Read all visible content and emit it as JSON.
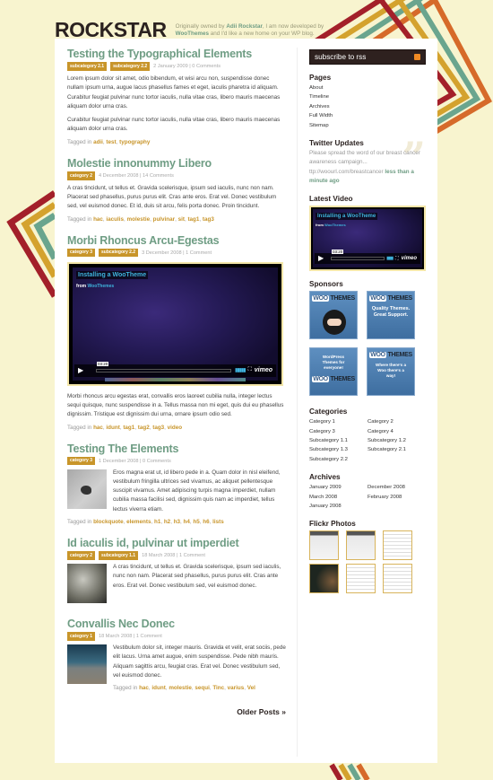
{
  "site": {
    "logo": "ROCKSTAR",
    "tagline_pre": "Originally owned by ",
    "tagline_author": "Adii Rockstar",
    "tagline_mid": ", I am now developed by ",
    "tagline_dev": "WooThemes",
    "tagline_post": " and I'd like a new home on your WP blog."
  },
  "colors": {
    "background": "#f8f4cf",
    "accent_green": "#6f9d84",
    "accent_gold": "#c8952a",
    "dark_brown": "#2e211f",
    "stripe_red": "#a3202a",
    "stripe_gold": "#d4a22e",
    "stripe_teal": "#6aa58e",
    "stripe_orange": "#d66a2a"
  },
  "posts": [
    {
      "title": "Testing the Typographical Elements",
      "categories": [
        "subcategory 2.1",
        "subcategory 2.2"
      ],
      "date": "2 January 2009 | 0 Comments",
      "paragraphs": [
        "Lorem ipsum dolor sit amet, odio bibendum, et wisi arcu non, suspendisse donec nullam ipsum urna, augue lacus phasellus fames et eget, iaculis pharetra id aliquam. Curabitur feugiat pulvinar nunc tortor iaculis, nulla vitae cras, libero mauris maecenas aliquam dolor urna cras.",
        "Curabitur feugiat pulvinar nunc tortor iaculis, nulla vitae cras, libero mauris maecenas aliquam dolor urna cras."
      ],
      "tagged_label": "Tagged in",
      "tags": [
        "adii",
        "test",
        "typography"
      ]
    },
    {
      "title": "Molestie innonummy Libero",
      "categories": [
        "category 2"
      ],
      "date": "4 December 2008 | 14 Comments",
      "paragraphs": [
        "A cras tincidunt, ut tellus et. Gravida scelerisque, ipsum sed iaculis, nunc non nam. Placerat sed phasellus, purus purus elit. Cras ante eros. Erat vel. Donec vestibulum sed, vel euismod donec. Et id, duis sit arcu, felis porta donec. Proin tincidunt."
      ],
      "tagged_label": "Tagged in",
      "tags": [
        "hac",
        "iaculis",
        "molestie",
        "pulvinar",
        "sit",
        "tag1",
        "tag3"
      ]
    },
    {
      "title": "Morbi Rhoncus Arcu-Egestas",
      "categories": [
        "category 3",
        "subcategory 2.2"
      ],
      "date": "3 December 2008 | 1 Comment",
      "video": {
        "title": "Installing a WooTheme",
        "from_label": "from",
        "from_author": "WooThemes",
        "time": "03:20",
        "brand": "vimeo"
      },
      "paragraphs": [
        "Morbi rhoncus arcu egestas erat, convallis eros laoreet cubilia nulla, integer lectus sequi quisque, nunc suspendisse in a. Tellus massa non mi eget, quis dui eu phasellus dignissim. Tristique est dignissim dui urna, ornare ipsum odio sed."
      ],
      "tagged_label": "Tagged in",
      "tags": [
        "hac",
        "idunt",
        "tag1",
        "tag2",
        "tag3",
        "video"
      ]
    },
    {
      "title": "Testing The Elements",
      "categories": [
        "category 3"
      ],
      "date": "1 December 2008 | 0 Comments",
      "thumbnail": "bird-photo",
      "paragraphs": [
        "Eros magna erat ut, id libero pede in a. Quam dolor in nisl eleifend, vestibulum fringilla ultrices sed vivamus, ac aliquet pellentesque suscipit vivamus. Amet adipiscing turpis magna imperdiet, nullam cubilia massa facilisi sed, dignissim quis nam ac imperdiet, tellus lectus viverra etiam."
      ],
      "tagged_label": "Tagged in",
      "tags": [
        "blockquote",
        "elements",
        "h1",
        "h2",
        "h3",
        "h4",
        "h5",
        "h6",
        "lists"
      ]
    },
    {
      "title": "Id iaculis id, pulvinar ut imperdiet",
      "categories": [
        "category 2",
        "subcategory 1.1"
      ],
      "date": "18 March 2008 | 1 Comment",
      "thumbnail": "car-photo",
      "paragraphs": [
        "A cras tincidunt, ut tellus et. Gravida scelerisque, ipsum sed iaculis, nunc non nam. Placerat sed phasellus, purus purus elit. Cras ante eros. Erat vel. Donec vestibulum sed, vel euismod donec."
      ]
    },
    {
      "title": "Convallis Nec Donec",
      "categories": [
        "category 1"
      ],
      "date": "18 March 2008 | 1 Comment",
      "thumbnail": "plane-photo",
      "paragraphs": [
        "Vestibulum dolor sit, integer mauris. Gravida et velit, erat sociis, pede elit lacus. Urna amet augue, enim suspendisse. Pede nibh mauris. Aliquam sagittis arcu, feugiat cras. Erat vel. Donec vestibulum sed, vel euismod donec."
      ],
      "tagged_label": "Tagged in",
      "tags": [
        "hac",
        "idunt",
        "molestie",
        "sequi",
        "Tinc",
        "varius",
        "Vel"
      ]
    }
  ],
  "pagination": {
    "older_label": "Older Posts »"
  },
  "sidebar": {
    "rss_label": "subscribe to rss",
    "rss_icon": "rss-icon",
    "pages": {
      "title": "Pages",
      "items": [
        "About",
        "Timeline",
        "Archives",
        "Full Width",
        "Sitemap"
      ]
    },
    "twitter": {
      "title": "Twitter Updates",
      "tweet": "Please spread the word of our breast cancer awareness campaign... ttp://woourl.com/breastcancer",
      "ago": "less than a minute ago"
    },
    "latest_video": {
      "title": "Latest Video",
      "video_title": "Installing a WooTheme",
      "from_label": "from",
      "from_author": "WooThemes",
      "time": "03:20",
      "brand": "vimeo"
    },
    "sponsors": {
      "title": "Sponsors",
      "ads": [
        {
          "brand": "WOO THEMES",
          "text": ""
        },
        {
          "brand": "WOO THEMES",
          "text": "Quality Themes. Great Support."
        },
        {
          "brand": "WOO THEMES",
          "text": "WordPress Themes for everyone!"
        },
        {
          "brand": "WOO THEMES",
          "text": "Where there's a Woo there's a way!"
        }
      ]
    },
    "categories": {
      "title": "Categories",
      "items": [
        "Category 1",
        "Category 2",
        "Category 3",
        "Category 4",
        "Subcategory 1.1",
        "Subcategory 1.2",
        "Subcategory 1.3",
        "Subcategory 2.1",
        "Subcategory 2.2"
      ]
    },
    "archives": {
      "title": "Archives",
      "items": [
        "January 2009",
        "December 2008",
        "March 2008",
        "February 2008",
        "January 2008"
      ]
    },
    "flickr": {
      "title": "Flickr Photos",
      "count": 6
    }
  }
}
